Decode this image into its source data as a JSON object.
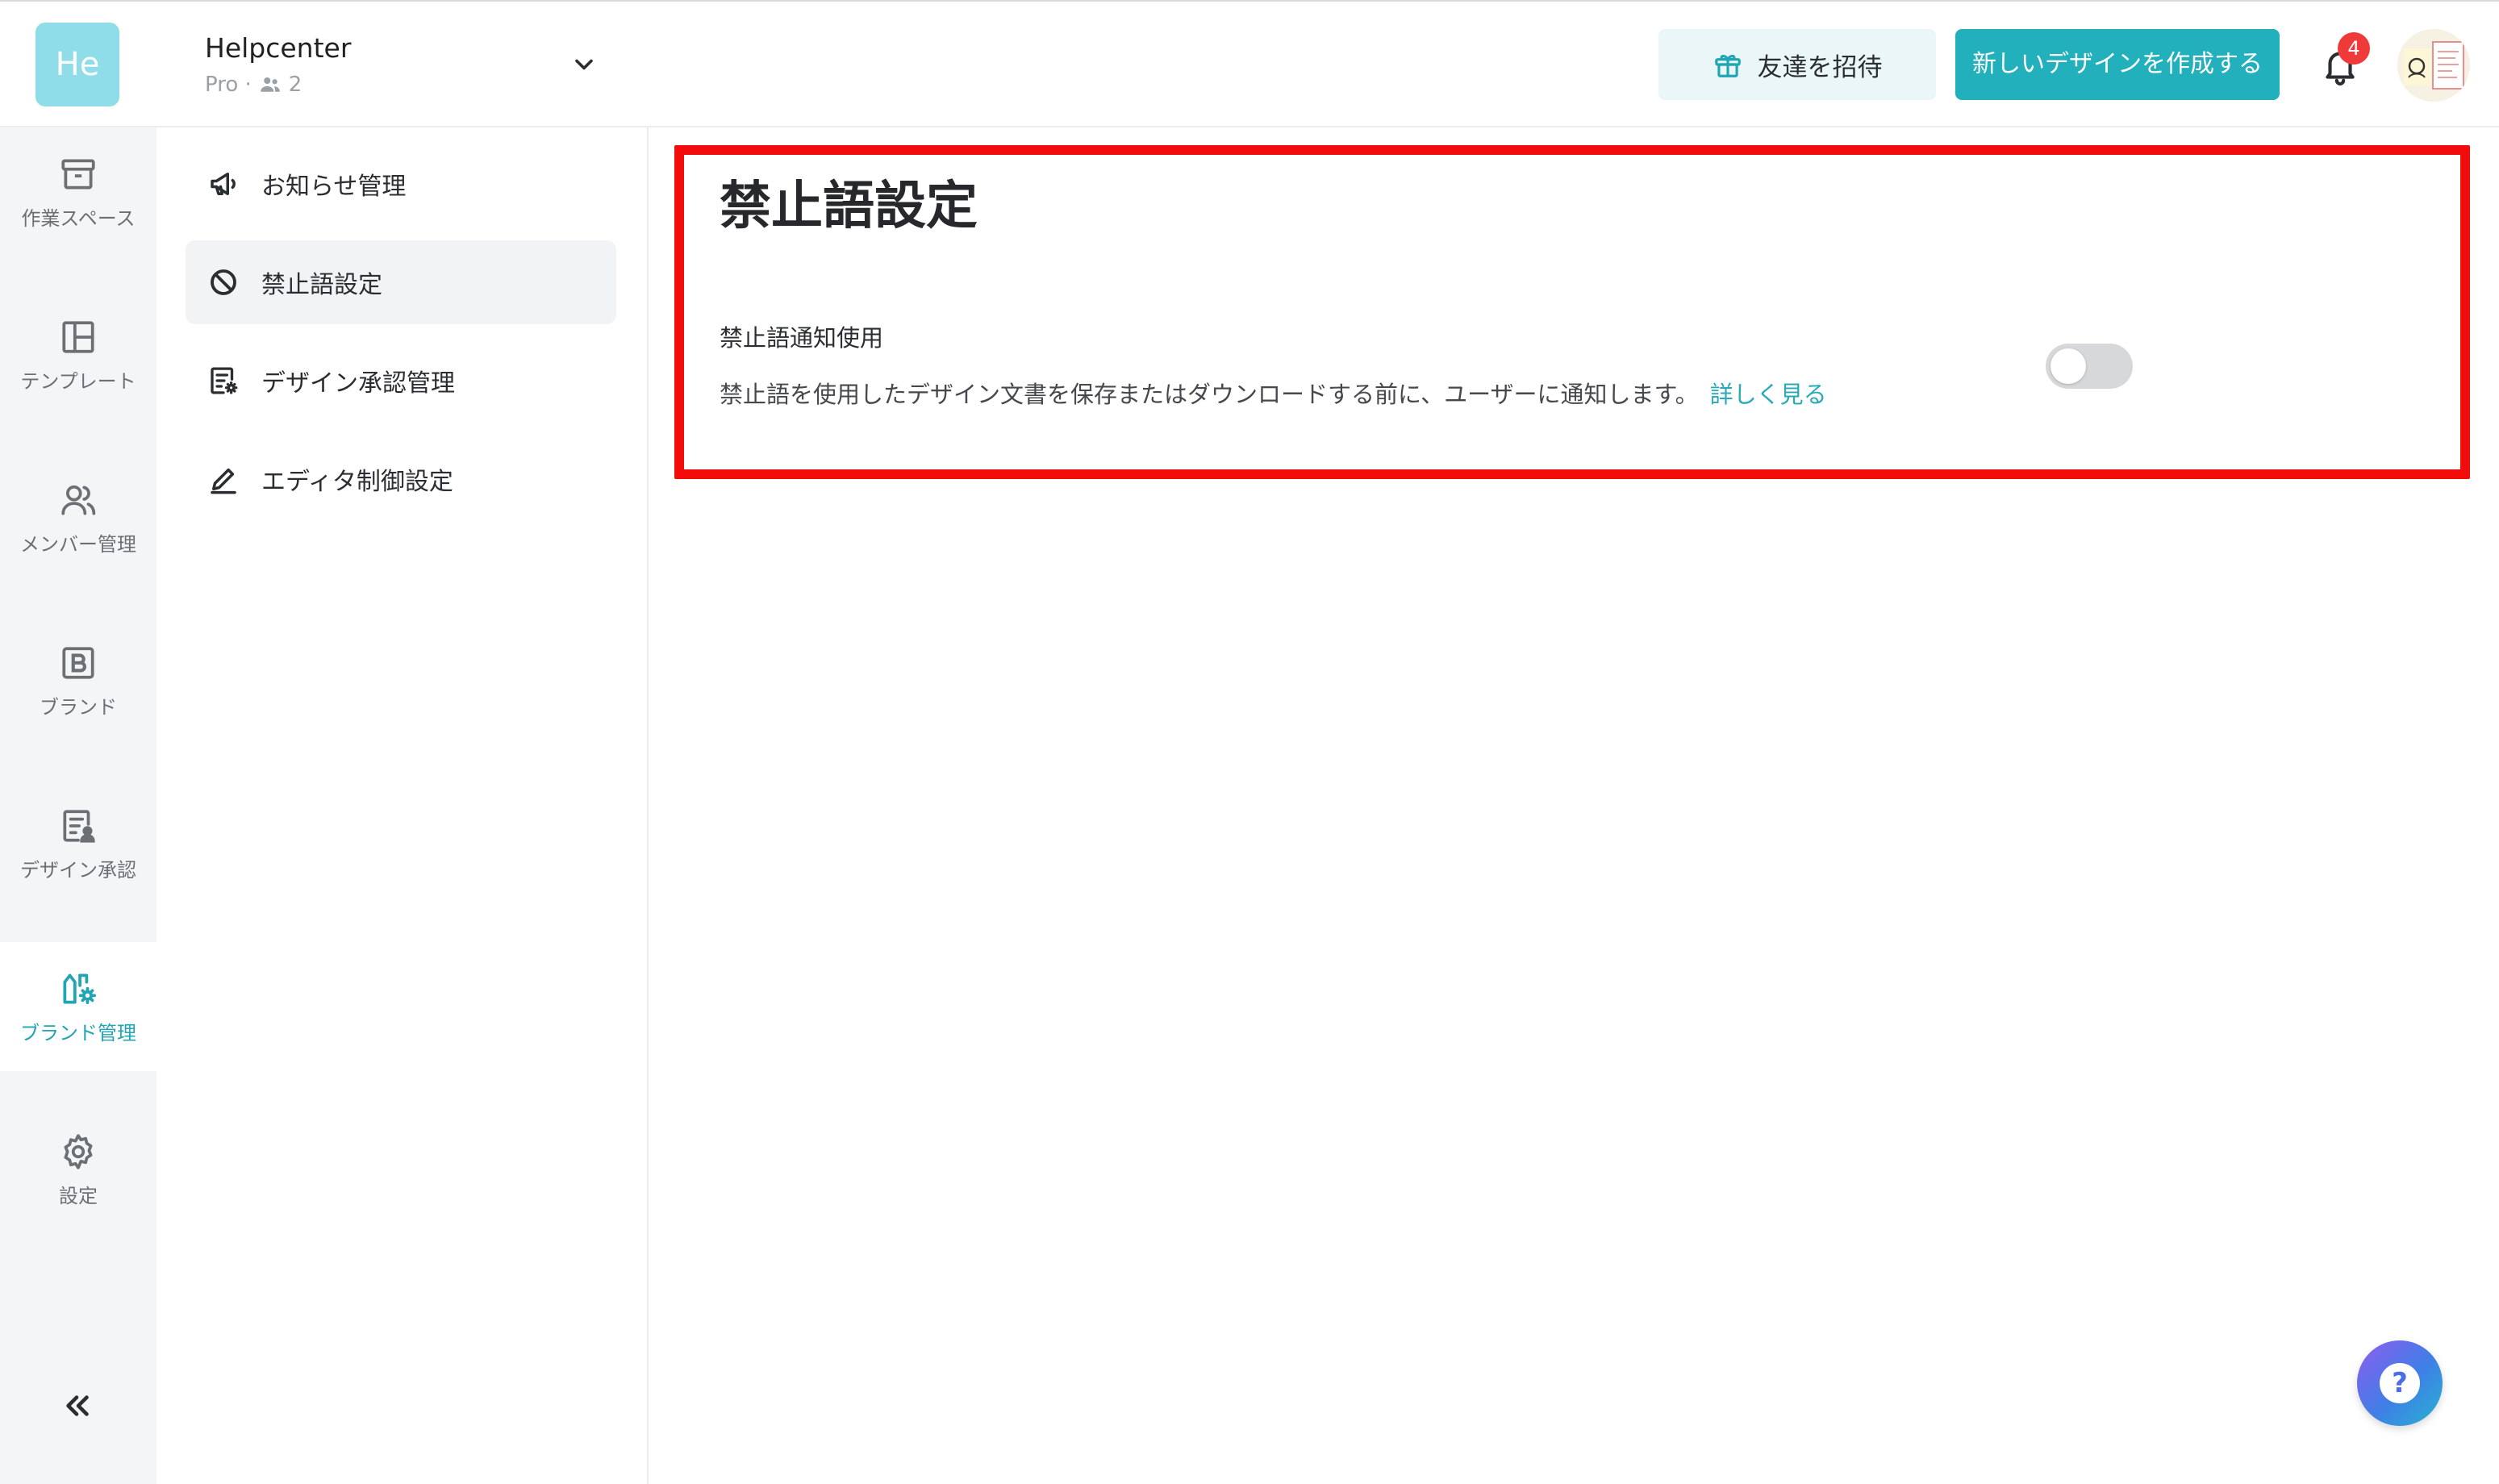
{
  "workspace": {
    "avatar_text": "He",
    "name": "Helpcenter",
    "plan": "Pro ·",
    "member_count": "2"
  },
  "header": {
    "invite_label": "友達を招待",
    "create_label": "新しいデザインを作成する",
    "notification_count": "4"
  },
  "rail": {
    "items": [
      {
        "label": "作業スペース",
        "icon": "archive-box-icon"
      },
      {
        "label": "テンプレート",
        "icon": "layout-template-icon"
      },
      {
        "label": "メンバー管理",
        "icon": "users-icon"
      },
      {
        "label": "ブランド",
        "icon": "brand-b-icon"
      },
      {
        "label": "デザイン承認",
        "icon": "document-approval-icon"
      },
      {
        "label": "ブランド管理",
        "icon": "brand-settings-icon",
        "active": true
      },
      {
        "label": "設定",
        "icon": "gear-icon"
      }
    ]
  },
  "subnav": {
    "items": [
      {
        "label": "お知らせ管理",
        "icon": "megaphone-icon"
      },
      {
        "label": "禁止語設定",
        "icon": "prohibited-icon",
        "active": true
      },
      {
        "label": "デザイン承認管理",
        "icon": "document-settings-icon"
      },
      {
        "label": "エディタ制御設定",
        "icon": "pencil-icon"
      }
    ]
  },
  "main": {
    "title": "禁止語設定",
    "setting": {
      "title": "禁止語通知使用",
      "description": "禁止語を使用したデザイン文書を保存またはダウンロードする前に、ユーザーに通知します。",
      "link_label": "詳しく見る",
      "enabled": false
    }
  },
  "colors": {
    "accent": "#22b0bc",
    "highlight_border": "#f20c0c",
    "badge": "#f03a3a"
  }
}
